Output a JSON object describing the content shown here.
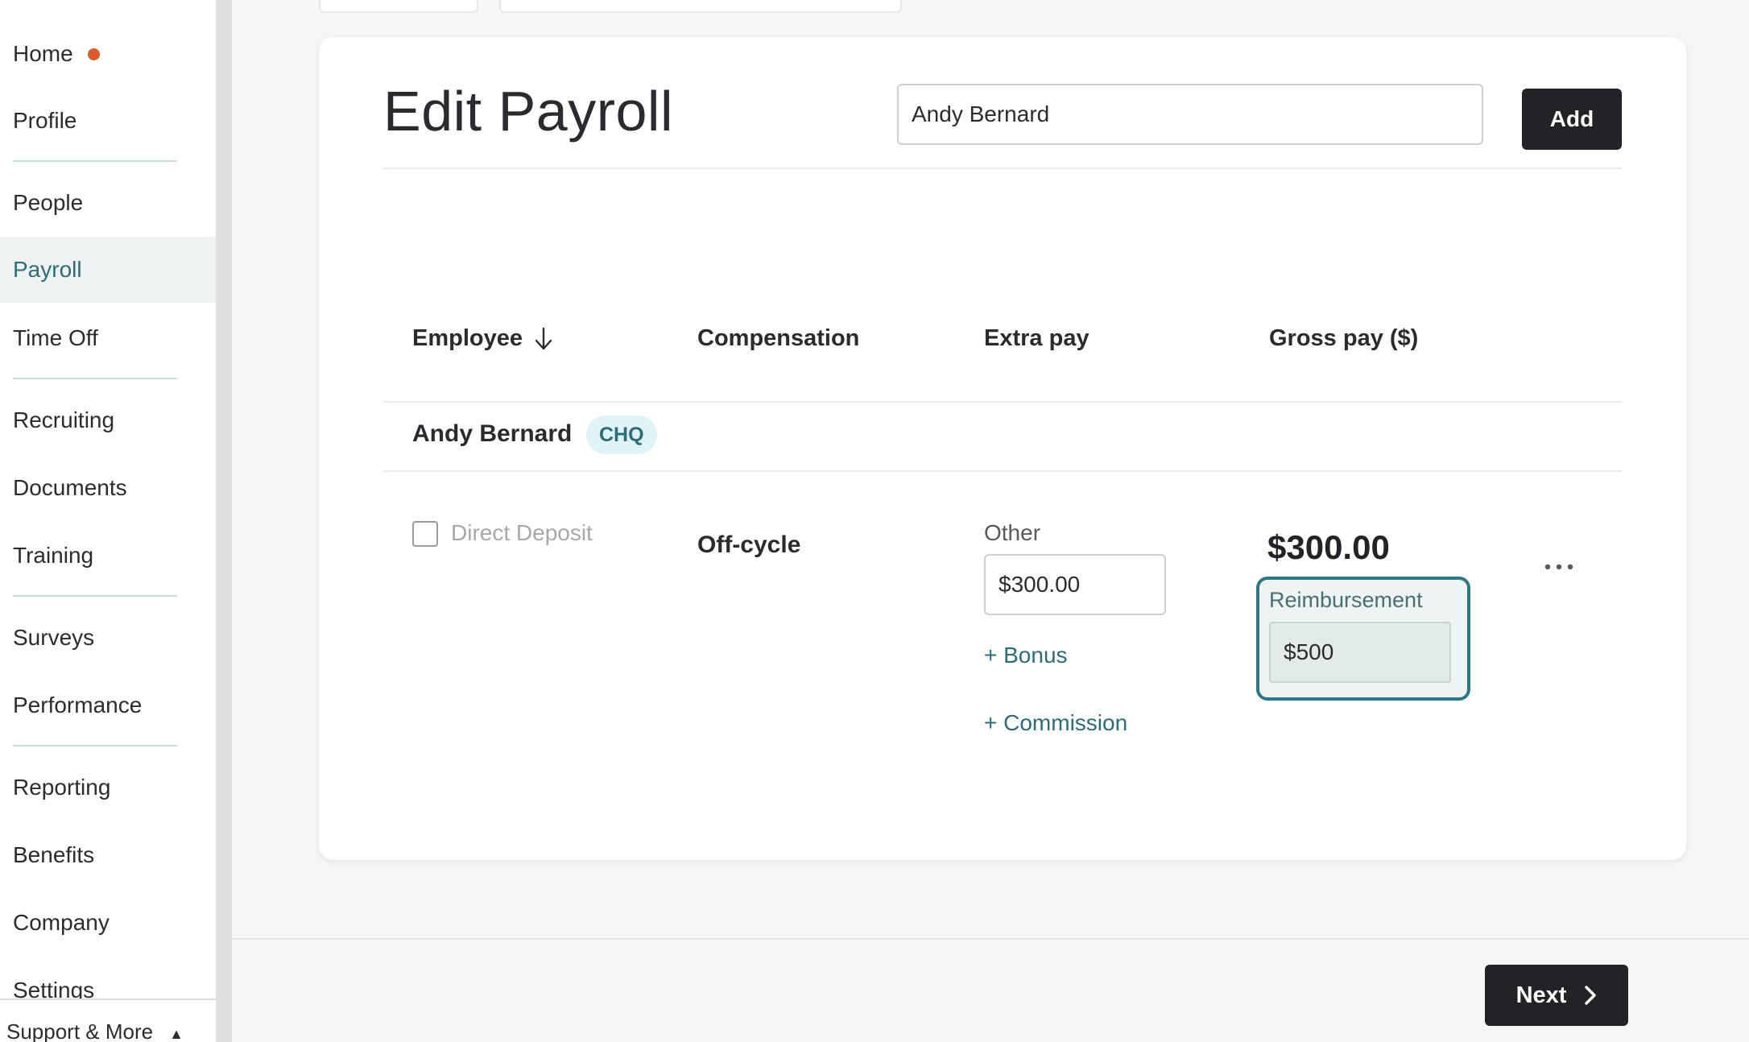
{
  "sidebar": {
    "items": [
      {
        "label": "Home",
        "notification": true
      },
      {
        "label": "Profile"
      },
      {
        "label": "People"
      },
      {
        "label": "Payroll",
        "active": true
      },
      {
        "label": "Time Off"
      },
      {
        "label": "Recruiting"
      },
      {
        "label": "Documents"
      },
      {
        "label": "Training"
      },
      {
        "label": "Surveys"
      },
      {
        "label": "Performance"
      },
      {
        "label": "Reporting"
      },
      {
        "label": "Benefits"
      },
      {
        "label": "Company"
      },
      {
        "label": "Settings"
      }
    ],
    "support_label": "Support & More"
  },
  "header": {
    "title": "Edit Payroll",
    "search_value": "Andy Bernard",
    "add_label": "Add"
  },
  "table": {
    "columns": [
      "Employee",
      "Compensation",
      "Extra pay",
      "Gross pay ($)"
    ],
    "sort_icon": "arrow-down-icon",
    "employee": {
      "name": "Andy Bernard",
      "badge": "CHQ",
      "direct_deposit_label": "Direct Deposit",
      "direct_deposit_checked": false,
      "compensation": "Off-cycle",
      "extra_pay": {
        "other_label": "Other",
        "other_value": "$300.00",
        "bonus_link": "+ Bonus",
        "commission_link": "+ Commission"
      },
      "gross_pay": "$300.00",
      "reimbursement_label": "Reimbursement",
      "reimbursement_value": "$500"
    }
  },
  "footer": {
    "next_label": "Next"
  },
  "colors": {
    "accent": "#2d6c78",
    "notification": "#dd5a2c",
    "primary_button": "#222326",
    "badge_bg": "#e0f4f7"
  }
}
